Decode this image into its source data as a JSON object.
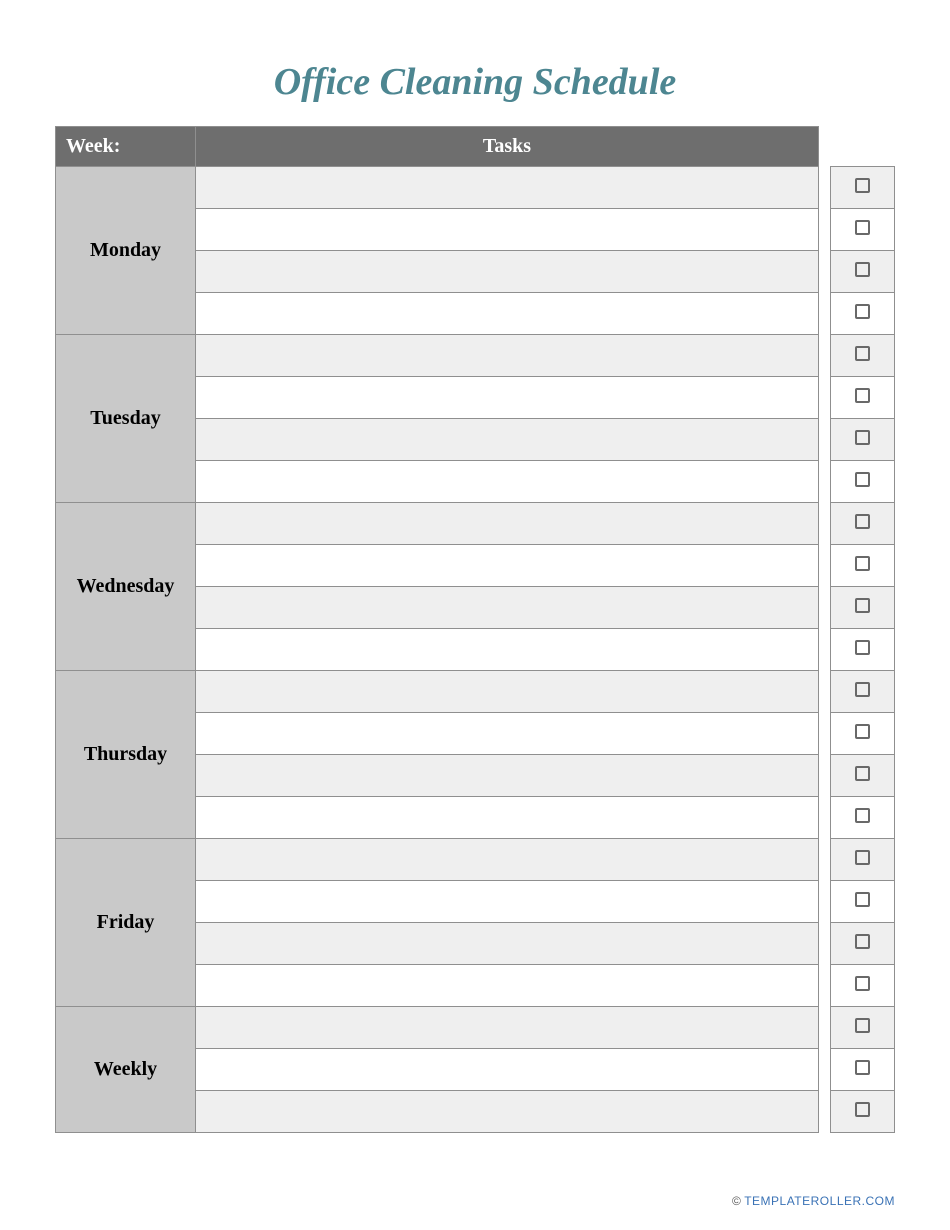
{
  "title": "Office Cleaning Schedule",
  "header": {
    "week": "Week:",
    "tasks": "Tasks"
  },
  "days": [
    "Monday",
    "Tuesday",
    "Wednesday",
    "Thursday",
    "Friday",
    "Weekly"
  ],
  "rows_per_day": [
    4,
    4,
    4,
    4,
    4,
    3
  ],
  "footer": {
    "copyright": "©",
    "site": "TEMPLATEROLLER.COM"
  }
}
